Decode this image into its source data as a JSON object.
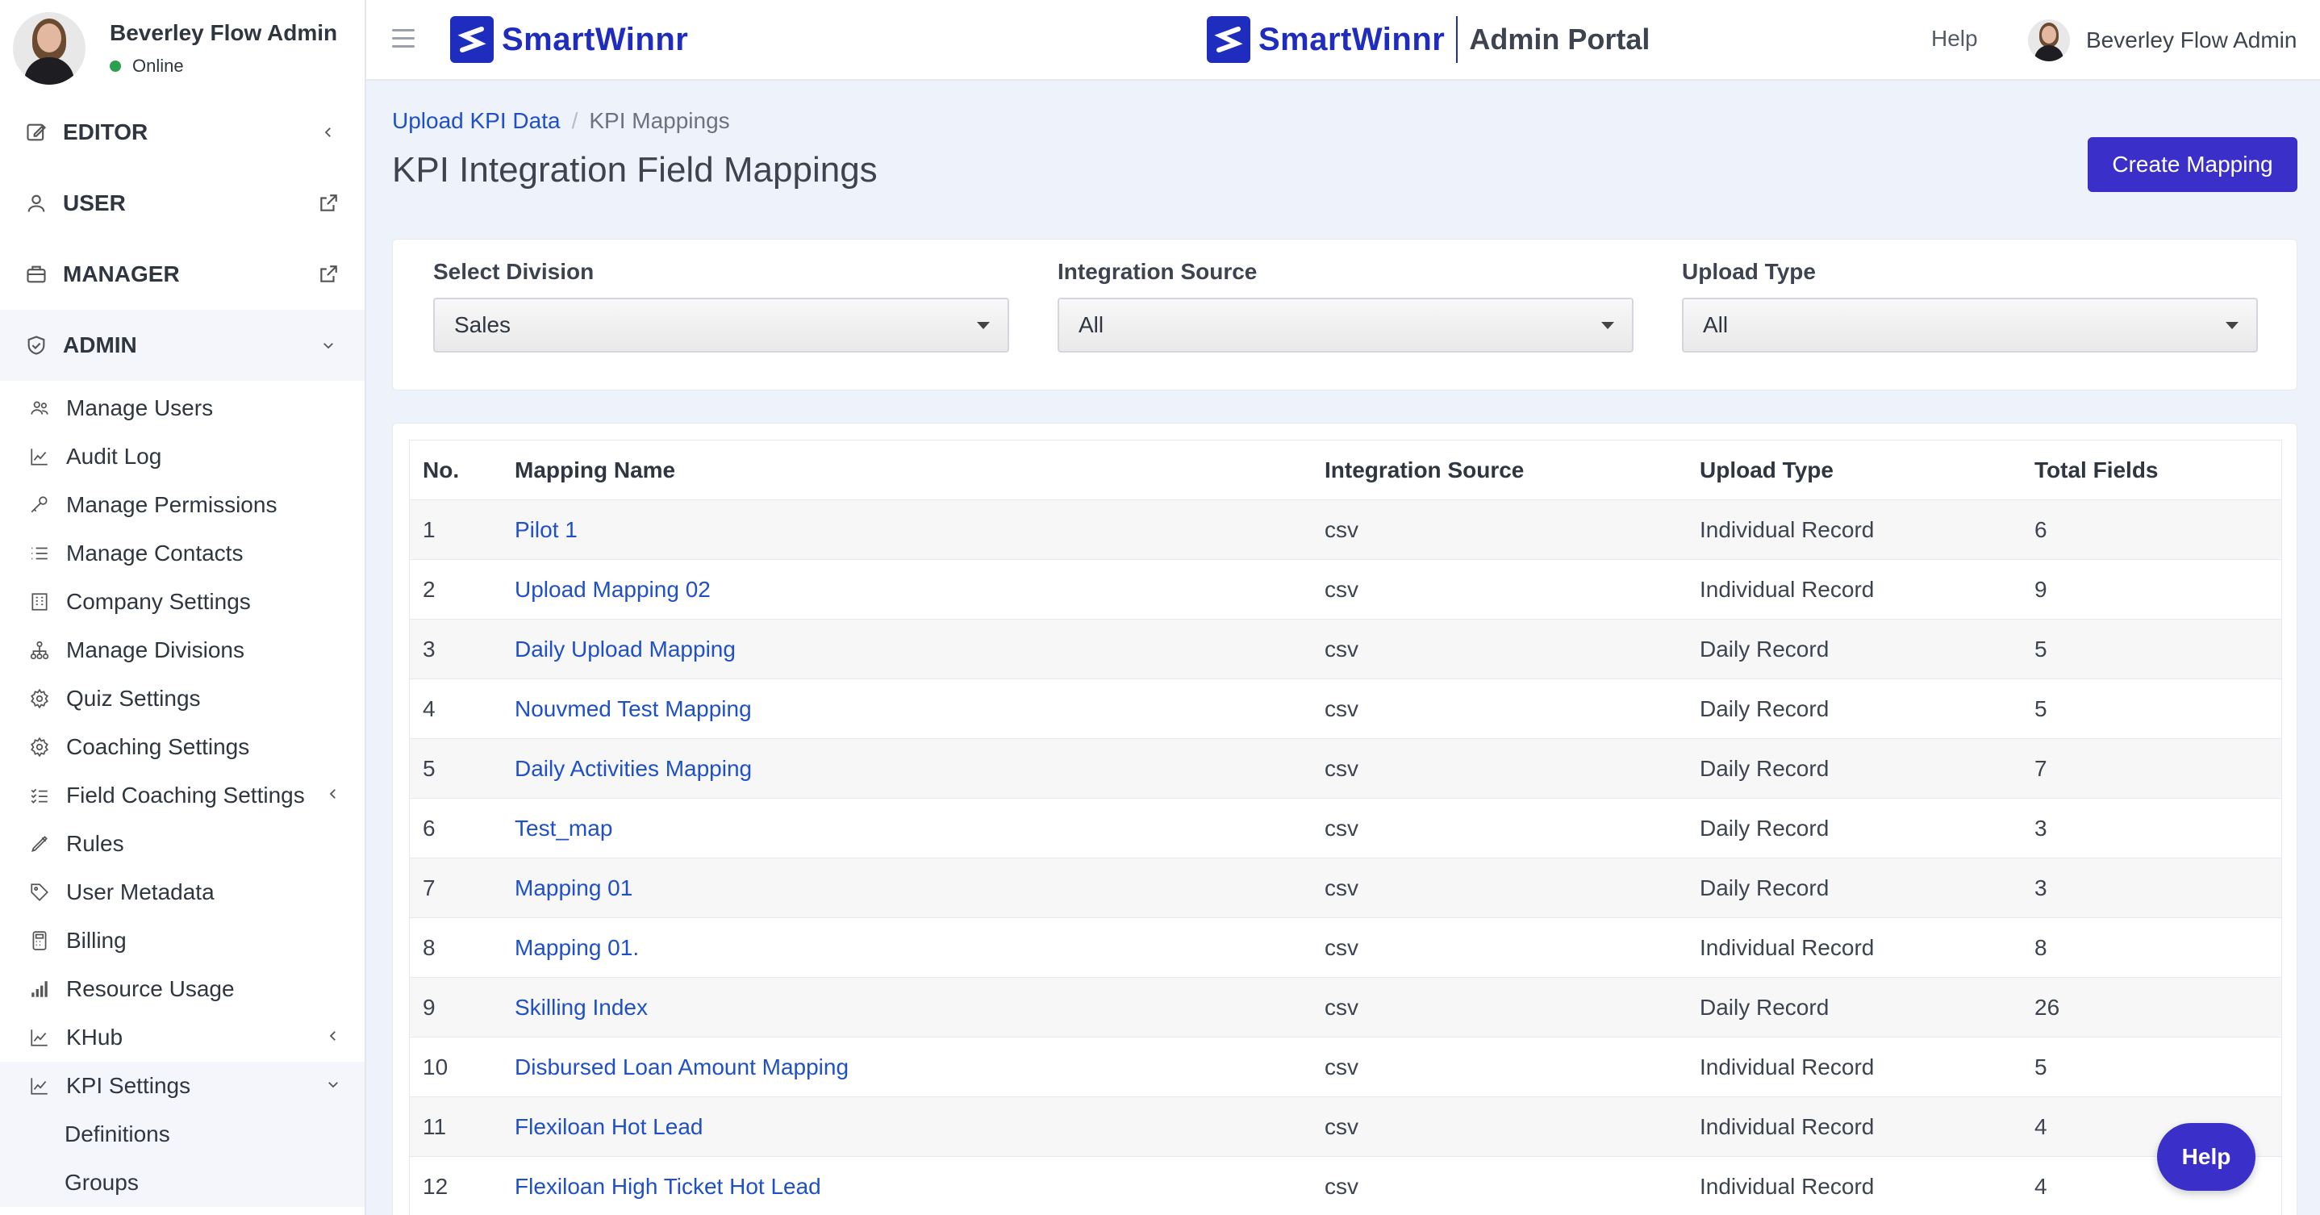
{
  "sidebar": {
    "user": {
      "name": "Beverley Flow Admin",
      "status": "Online"
    },
    "sections": [
      {
        "label": "EDITOR",
        "icon": "edit-icon",
        "right": "chevron-left-icon"
      },
      {
        "label": "USER",
        "icon": "user-icon",
        "right": "external-link-icon"
      },
      {
        "label": "MANAGER",
        "icon": "briefcase-icon",
        "right": "external-link-icon"
      },
      {
        "label": "ADMIN",
        "icon": "shield-icon",
        "right": "chevron-down-icon"
      }
    ],
    "admin_items": [
      {
        "label": "Manage Users",
        "icon": "users-icon"
      },
      {
        "label": "Audit Log",
        "icon": "chart-line-icon"
      },
      {
        "label": "Manage Permissions",
        "icon": "key-icon"
      },
      {
        "label": "Manage Contacts",
        "icon": "list-icon"
      },
      {
        "label": "Company Settings",
        "icon": "building-icon"
      },
      {
        "label": "Manage Divisions",
        "icon": "sitemap-icon"
      },
      {
        "label": "Quiz Settings",
        "icon": "gear-icon"
      },
      {
        "label": "Coaching Settings",
        "icon": "gear-icon"
      },
      {
        "label": "Field Coaching Settings",
        "icon": "tasks-icon"
      },
      {
        "label": "Rules",
        "icon": "pen-icon"
      },
      {
        "label": "User Metadata",
        "icon": "tag-icon"
      },
      {
        "label": "Billing",
        "icon": "calculator-icon"
      },
      {
        "label": "Resource Usage",
        "icon": "signal-icon"
      },
      {
        "label": "KHub",
        "icon": "chart-line-icon"
      },
      {
        "label": "KPI Settings",
        "icon": "chart-line-icon"
      }
    ],
    "kpi_sub_items": [
      "Definitions",
      "Groups"
    ]
  },
  "topbar": {
    "brand": "SmartWinnr",
    "portal": "Admin Portal",
    "help": "Help",
    "user_name": "Beverley Flow Admin"
  },
  "breadcrumb": {
    "link": "Upload KPI Data",
    "separator": "/",
    "current": "KPI Mappings"
  },
  "page": {
    "title": "KPI Integration Field Mappings",
    "create_button": "Create Mapping"
  },
  "filters": [
    {
      "label": "Select Division",
      "value": "Sales"
    },
    {
      "label": "Integration Source",
      "value": "All"
    },
    {
      "label": "Upload Type",
      "value": "All"
    }
  ],
  "table": {
    "headers": [
      "No.",
      "Mapping Name",
      "Integration Source",
      "Upload Type",
      "Total Fields"
    ],
    "rows": [
      [
        "1",
        "Pilot 1",
        "csv",
        "Individual Record",
        "6"
      ],
      [
        "2",
        "Upload Mapping 02",
        "csv",
        "Individual Record",
        "9"
      ],
      [
        "3",
        "Daily Upload Mapping",
        "csv",
        "Daily Record",
        "5"
      ],
      [
        "4",
        "Nouvmed Test Mapping",
        "csv",
        "Daily Record",
        "5"
      ],
      [
        "5",
        "Daily Activities Mapping",
        "csv",
        "Daily Record",
        "7"
      ],
      [
        "6",
        "Test_map",
        "csv",
        "Daily Record",
        "3"
      ],
      [
        "7",
        "Mapping 01",
        "csv",
        "Daily Record",
        "3"
      ],
      [
        "8",
        "Mapping 01.",
        "csv",
        "Individual Record",
        "8"
      ],
      [
        "9",
        "Skilling Index",
        "csv",
        "Daily Record",
        "26"
      ],
      [
        "10",
        "Disbursed Loan Amount Mapping",
        "csv",
        "Individual Record",
        "5"
      ],
      [
        "11",
        "Flexiloan Hot Lead",
        "csv",
        "Individual Record",
        "4"
      ],
      [
        "12",
        "Flexiloan High Ticket Hot Lead",
        "csv",
        "Individual Record",
        "4"
      ]
    ]
  },
  "help_fab": "Help",
  "colors": {
    "brand": "#1f2dbf",
    "primary_button": "#3b2fc9",
    "link": "#1f50c8"
  }
}
